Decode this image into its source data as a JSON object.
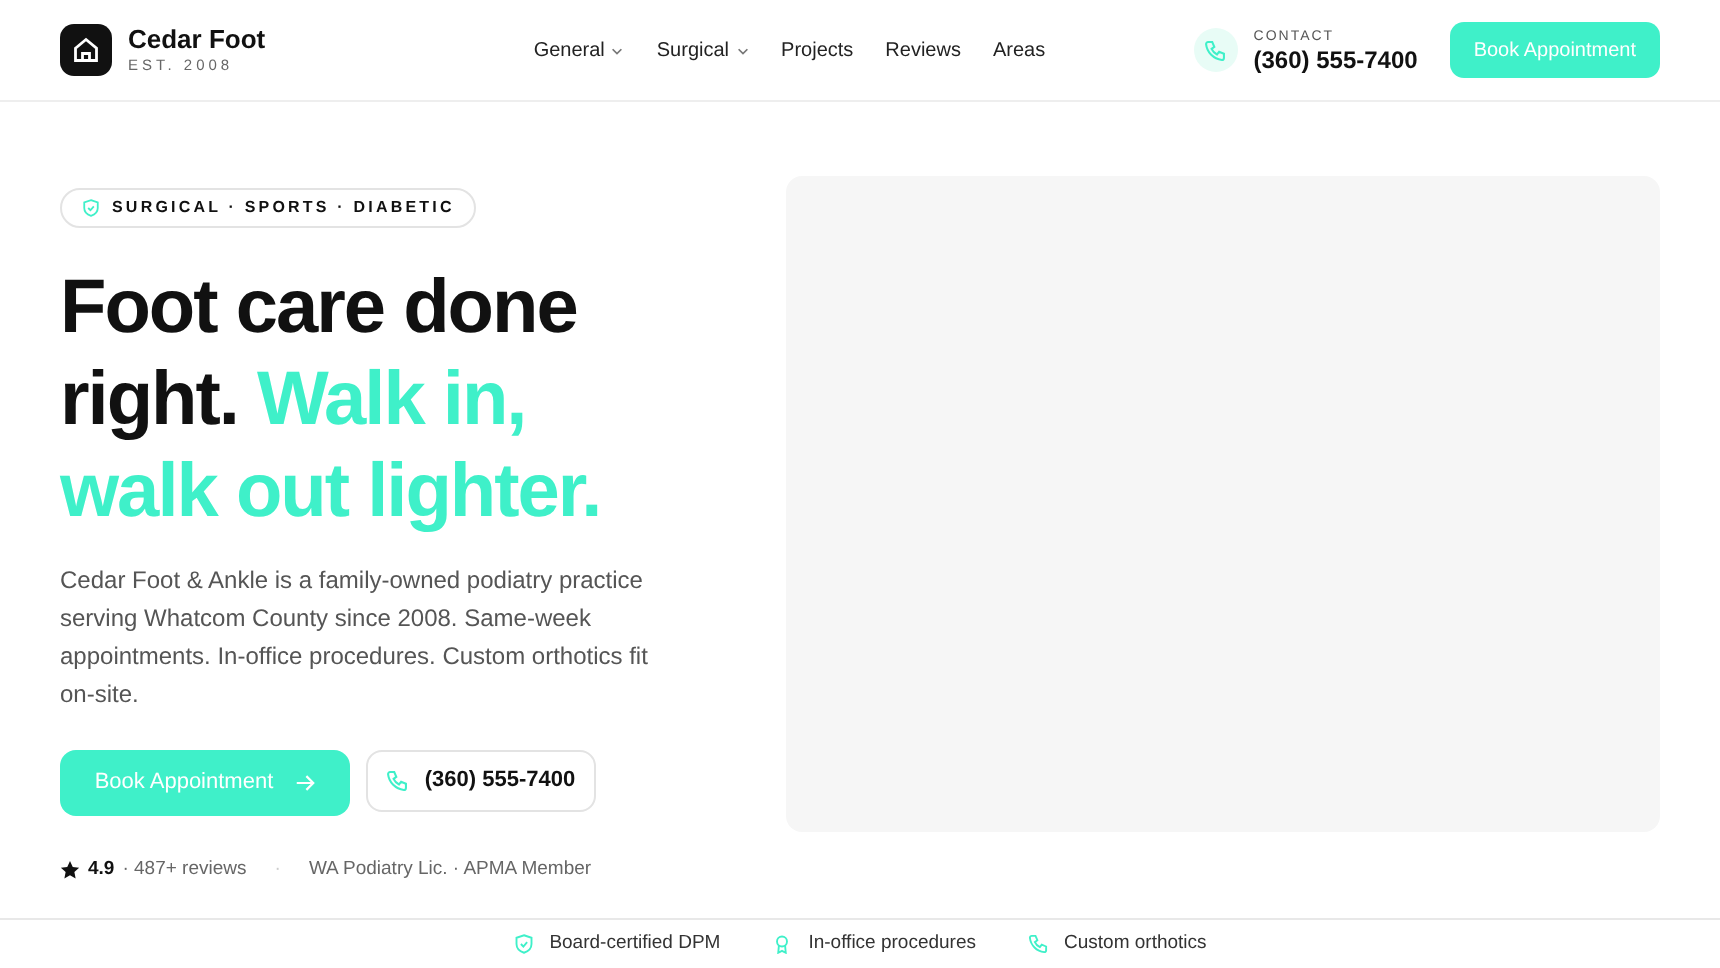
{
  "brand": {
    "name": "Cedar Foot",
    "tagline": "EST. 2008"
  },
  "nav": [
    {
      "label": "General",
      "dropdown": true
    },
    {
      "label": "Surgical",
      "dropdown": true
    },
    {
      "label": "Projects",
      "dropdown": false
    },
    {
      "label": "Reviews",
      "dropdown": false
    },
    {
      "label": "Areas",
      "dropdown": false
    }
  ],
  "contact": {
    "label": "CONTACT",
    "phone": "(360) 555-7400"
  },
  "header_button": "Book Appointment",
  "hero": {
    "pill": "SURGICAL · SPORTS · DIABETIC",
    "headline": "Foot care done right.",
    "headline_accent": "Walk in, walk out lighter.",
    "body": "Cedar Foot & Ankle is a family-owned podiatry practice serving Whatcom County since 2008. Same-week appointments. In-office procedures. Custom orthotics fit on-site.",
    "primary_button": "Book Appointment",
    "phone_button": "(360) 555-7400",
    "rating": "4.9",
    "reviews": "· 487+ reviews",
    "separator": "·",
    "credentials": "WA Podiatry Lic. · APMA Member"
  },
  "trust": [
    {
      "kind": "shield",
      "label": "Board-certified DPM"
    },
    {
      "kind": "award",
      "label": "In-office procedures"
    },
    {
      "kind": "phone",
      "label": "Custom orthotics"
    }
  ]
}
